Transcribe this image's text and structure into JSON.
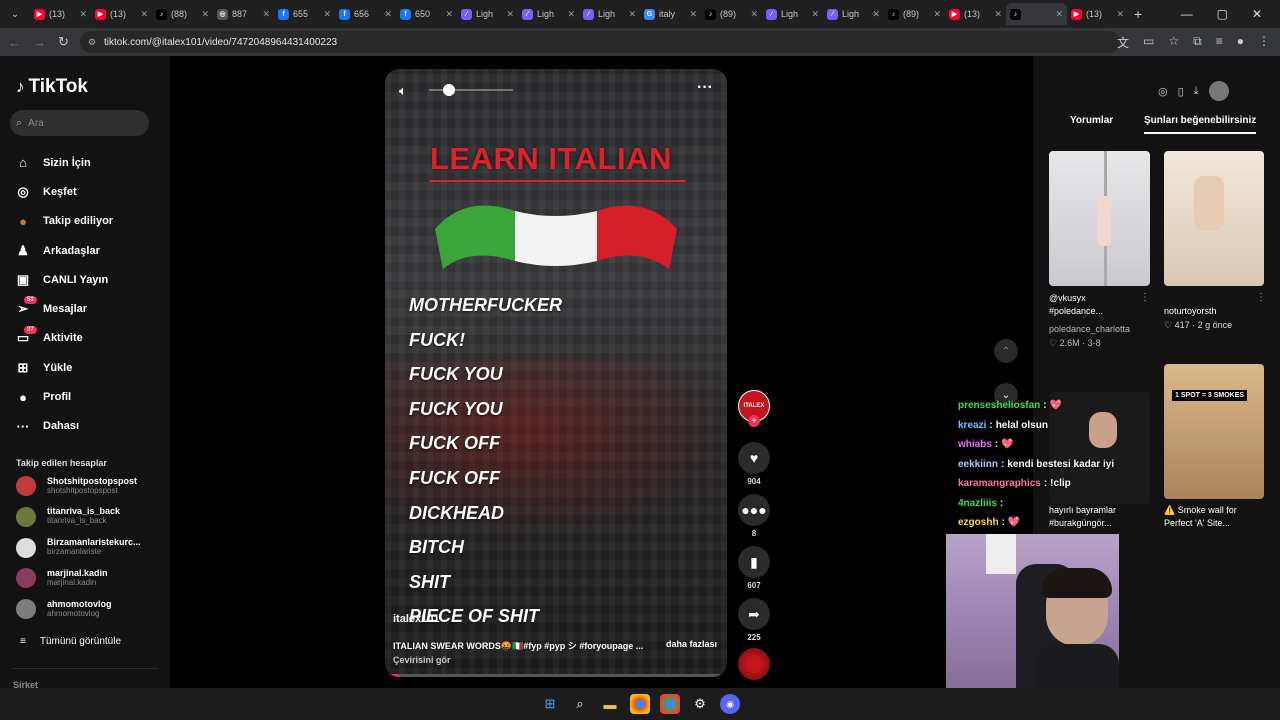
{
  "browser": {
    "tabs": [
      {
        "label": "(13)",
        "icon": "youtube-icon",
        "color": "#ff0033"
      },
      {
        "label": "(13)",
        "icon": "youtube-icon",
        "color": "#ff0033"
      },
      {
        "label": "(88)",
        "icon": "tiktok-icon",
        "color": "#000000"
      },
      {
        "label": "887",
        "icon": "globe-icon",
        "color": "#555555"
      },
      {
        "label": "655",
        "icon": "facebook-icon",
        "color": "#1877f2"
      },
      {
        "label": "656",
        "icon": "facebook-icon",
        "color": "#1877f2"
      },
      {
        "label": "650",
        "icon": "facebook-icon",
        "color": "#1877f2"
      },
      {
        "label": "Ligh",
        "icon": "feather-icon",
        "color": "#7a5cff"
      },
      {
        "label": "Ligh",
        "icon": "feather-icon",
        "color": "#7a5cff"
      },
      {
        "label": "Ligh",
        "icon": "feather-icon",
        "color": "#7a5cff"
      },
      {
        "label": "italy",
        "icon": "google-icon",
        "color": "#4285f4"
      },
      {
        "label": "(89)",
        "icon": "tiktok-icon",
        "color": "#000000"
      },
      {
        "label": "Ligh",
        "icon": "feather-icon",
        "color": "#7a5cff"
      },
      {
        "label": "Ligh",
        "icon": "feather-icon",
        "color": "#7a5cff"
      },
      {
        "label": "(89)",
        "icon": "tiktok-icon",
        "color": "#000000"
      },
      {
        "label": "(13)",
        "icon": "youtube-icon",
        "color": "#ff0033"
      },
      {
        "label": "",
        "icon": "tiktok-icon",
        "color": "#000000",
        "active": true
      },
      {
        "label": "(13)",
        "icon": "youtube-icon",
        "color": "#ff0033"
      }
    ],
    "url": "tiktok.com/@italex101/video/7472048964431400223"
  },
  "sidebar": {
    "logo": "TikTok",
    "search_placeholder": "Ara",
    "nav": [
      {
        "label": "Sizin İçin",
        "icon": "home-icon"
      },
      {
        "label": "Keşfet",
        "icon": "compass-icon"
      },
      {
        "label": "Takip ediliyor",
        "icon": "following-icon"
      },
      {
        "label": "Arkadaşlar",
        "icon": "friends-icon"
      },
      {
        "label": "CANLI Yayın",
        "icon": "live-icon"
      },
      {
        "label": "Mesajlar",
        "icon": "messages-icon",
        "badge": "53"
      },
      {
        "label": "Aktivite",
        "icon": "activity-icon",
        "badge": "37"
      },
      {
        "label": "Yükle",
        "icon": "upload-icon"
      },
      {
        "label": "Profil",
        "icon": "profile-icon"
      },
      {
        "label": "Dahası",
        "icon": "more-icon"
      }
    ],
    "following_title": "Takip edilen hesaplar",
    "accounts": [
      {
        "name": "Shotshitpostopspost",
        "user": "shotshitpostopspost",
        "color": "#c23b3b"
      },
      {
        "name": "titanriva_is_back",
        "user": "titanriva_is_back",
        "color": "#6b7a3a"
      },
      {
        "name": "Birzamanlaristekurc...",
        "user": "birzamanlariste",
        "color": "#ddd"
      },
      {
        "name": "marjinal.kadin",
        "user": "marjinal.kadin",
        "color": "#8a3a5a"
      },
      {
        "name": "ahmomotovlog",
        "user": "ahmomotovlog",
        "color": "#7d7d7d"
      }
    ],
    "see_all": "Tümünü görüntüle",
    "company": "Şirket"
  },
  "video": {
    "title": "LEARN ITALIAN",
    "words": [
      "MOTHERFUCKER",
      "FUCK!",
      "FUCK YOU",
      "FUCK YOU",
      "FUCK OFF",
      "FUCK OFF",
      "DICKHEAD",
      "BITCH",
      "SHIT",
      "PIECE OF SHIT"
    ],
    "author": "italex101",
    "caption": "ITALIAN SWEAR WORDS🤬🇮🇹#fyp #pyp シ #foryoupage ...",
    "more": "daha fazlası",
    "translate": "Çevirisini gör",
    "progress_fraction": 0.04
  },
  "actions": {
    "avatar_label": "ITALEX",
    "likes": "904",
    "comments": "8",
    "saves": "607",
    "shares": "225"
  },
  "right_panel": {
    "tabs": [
      "Yorumlar",
      "Şunları beğenebilirsiniz"
    ],
    "items": [
      {
        "caption_1": "@vkusyx",
        "caption_2": "#poledance...",
        "sub": "poledance_charlotta",
        "stats": "♡ 2.6M · 3-8"
      },
      {
        "caption_1": "noturtoyorsth",
        "stats": "♡ 417 · 2 g önce"
      },
      {
        "caption_1": "hayırlı bayramlar",
        "caption_2": "#burakgüngör..."
      },
      {
        "caption_1": "⚠️ Smoke wall for",
        "caption_2": "Perfect 'A' Site...",
        "thumb_label": "1 SPOT = 3 SMOKES"
      }
    ]
  },
  "overlay_chat": [
    {
      "user": "prensesheliosfan",
      "color": "#48d94e",
      "msg": "💖"
    },
    {
      "user": "kreazi",
      "color": "#6fc3ff",
      "msg": "helal olsun"
    },
    {
      "user": "whiabs",
      "color": "#e86fff",
      "msg": "💖"
    },
    {
      "user": "eekkiinn",
      "color": "#a8c8ff",
      "msg": "kendi bestesi kadar iyi"
    },
    {
      "user": "karamangraphics",
      "color": "#ff6fa8",
      "msg": "!clip"
    },
    {
      "user": "4nazliiis",
      "color": "#48d94e",
      "msg": ""
    },
    {
      "user": "ezgoshh",
      "color": "#ffd84a",
      "msg": "💖"
    }
  ]
}
